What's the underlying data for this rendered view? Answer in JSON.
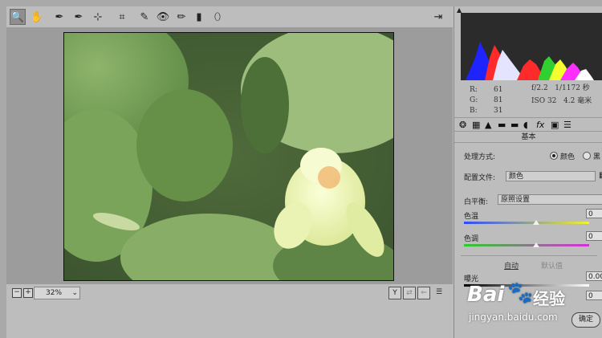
{
  "toolbar": {
    "tools": [
      {
        "name": "zoom-icon",
        "glyph": "🔍"
      },
      {
        "name": "hand-icon",
        "glyph": "✋"
      },
      {
        "name": "eyedropper-icon",
        "glyph": "✒"
      },
      {
        "name": "color-sampler-icon",
        "glyph": "✒"
      },
      {
        "name": "target-adjust-icon",
        "glyph": "⊹"
      },
      {
        "name": "crop-icon",
        "glyph": "⌗"
      },
      {
        "name": "spot-removal-icon",
        "glyph": "✎"
      },
      {
        "name": "red-eye-icon",
        "glyph": "👁"
      },
      {
        "name": "brush-icon",
        "glyph": "✏"
      },
      {
        "name": "graduated-filter-icon",
        "glyph": "▮"
      },
      {
        "name": "radial-filter-icon",
        "glyph": "⬯"
      }
    ],
    "open_object_glyph": "⇥"
  },
  "status": {
    "minus": "−",
    "plus": "+",
    "zoom_value": "32%",
    "zoom_dropdown": "⌄",
    "y_button": "Y",
    "settings_glyph": "☰"
  },
  "histogram": {
    "clip_glyph": "▲"
  },
  "readout": {
    "r_label": "R:",
    "r_value": "61",
    "g_label": "G:",
    "g_value": "81",
    "b_label": "B:",
    "b_value": "31",
    "aperture": "f/2.2",
    "shutter": "1/1172 秒",
    "iso": "ISO 32",
    "focal": "4.2 毫米"
  },
  "tabs": [
    "❂",
    "▦",
    "▲",
    "▬",
    "▬",
    "◖",
    "fx",
    "▣",
    "☰"
  ],
  "basic": {
    "section_title": "基本",
    "treatment_label": "处理方式:",
    "color_option": "颜色",
    "bw_option": "黑",
    "profile_label": "配置文件:",
    "profile_value": "颜色",
    "wb_label": "白平衡:",
    "wb_value": "原照设置",
    "temp_label": "色温",
    "temp_value": "0",
    "tint_label": "色调",
    "tint_value": "0",
    "auto_link": "自动",
    "default_link": "默认值",
    "exposure_label": "曝光",
    "exposure_value": "0.00",
    "contrast_value": "0"
  },
  "buttons": {
    "ok": "确定"
  },
  "watermark": {
    "brand": "Bai",
    "brand2": "经验",
    "url": "jingyan.baidu.com"
  },
  "colors": {
    "accent_blue": "#2b2bff",
    "highlight_green": "#2bd12b",
    "red": "#ff1a1a",
    "yellow": "#f3ff2b"
  }
}
